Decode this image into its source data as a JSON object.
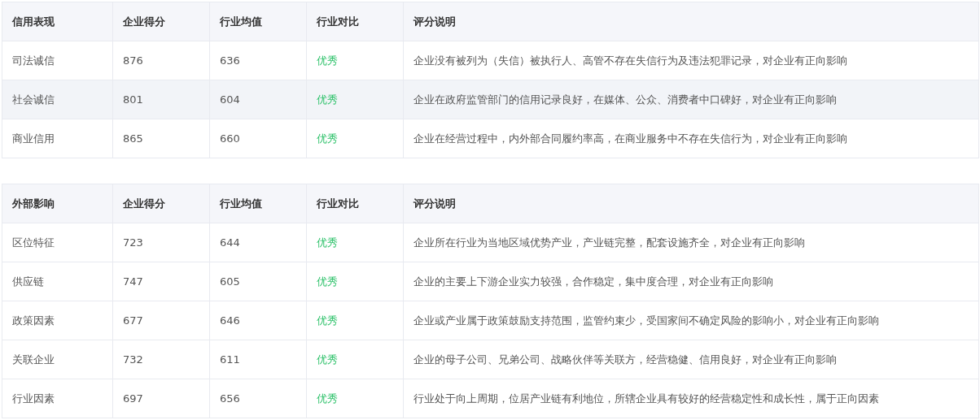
{
  "tables": [
    {
      "columns": [
        "信用表现",
        "企业得分",
        "行业均值",
        "行业对比",
        "评分说明"
      ],
      "rows": [
        {
          "cells": [
            "司法诚信",
            "876",
            "636",
            "优秀",
            "企业没有被列为（失信）被执行人、高管不存在失信行为及违法犯罪记录，对企业有正向影响"
          ],
          "highlighted": false
        },
        {
          "cells": [
            "社会诚信",
            "801",
            "604",
            "优秀",
            "企业在政府监管部门的信用记录良好，在媒体、公众、消费者中口碑好，对企业有正向影响"
          ],
          "highlighted": true
        },
        {
          "cells": [
            "商业信用",
            "865",
            "660",
            "优秀",
            "企业在经营过程中，内外部合同履约率高，在商业服务中不存在失信行为，对企业有正向影响"
          ],
          "highlighted": false
        }
      ]
    },
    {
      "columns": [
        "外部影响",
        "企业得分",
        "行业均值",
        "行业对比",
        "评分说明"
      ],
      "rows": [
        {
          "cells": [
            "区位特征",
            "723",
            "644",
            "优秀",
            "企业所在行业为当地区域优势产业，产业链完整，配套设施齐全，对企业有正向影响"
          ],
          "highlighted": false
        },
        {
          "cells": [
            "供应链",
            "747",
            "605",
            "优秀",
            "企业的主要上下游企业实力较强，合作稳定，集中度合理，对企业有正向影响"
          ],
          "highlighted": false
        },
        {
          "cells": [
            "政策因素",
            "677",
            "646",
            "优秀",
            "企业或产业属于政策鼓励支持范围，监管约束少，受国家间不确定风险的影响小，对企业有正向影响"
          ],
          "highlighted": false
        },
        {
          "cells": [
            "关联企业",
            "732",
            "611",
            "优秀",
            "企业的母子公司、兄弟公司、战略伙伴等关联方，经营稳健、信用良好，对企业有正向影响"
          ],
          "highlighted": false
        },
        {
          "cells": [
            "行业因素",
            "697",
            "656",
            "优秀",
            "行业处于向上周期，位居产业链有利地位，所辖企业具有较好的经营稳定性和成长性，属于正向因素"
          ],
          "highlighted": false
        }
      ]
    }
  ]
}
